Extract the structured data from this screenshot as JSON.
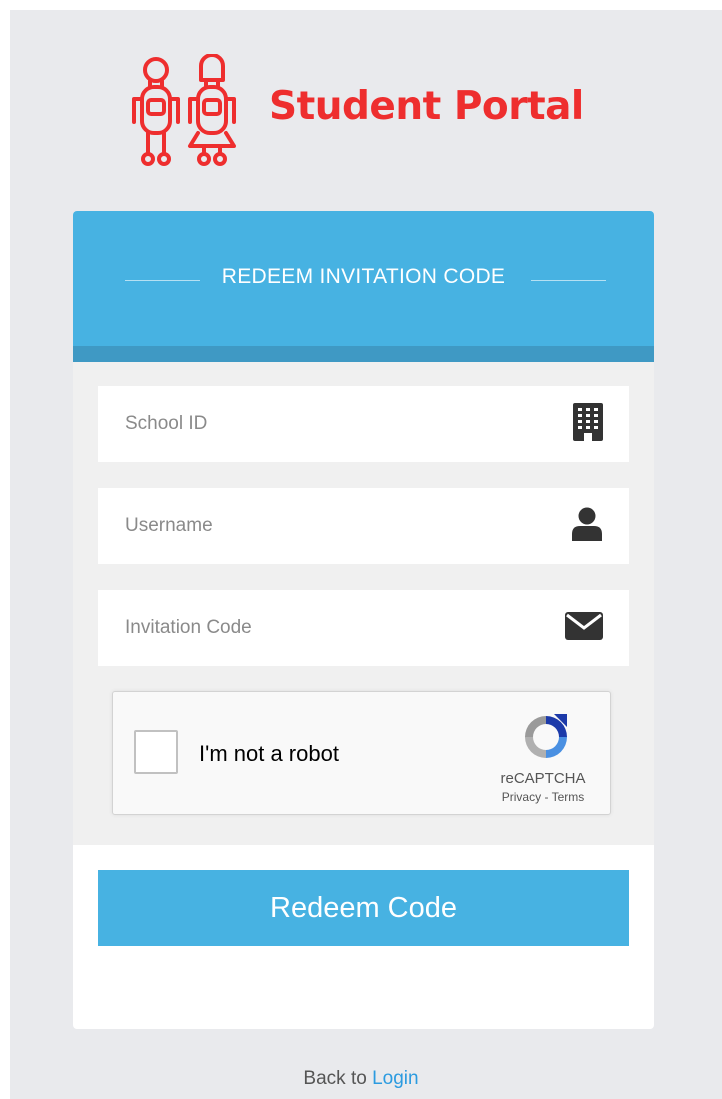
{
  "brand": {
    "title": "Student Portal",
    "logo_icon": "students-icon",
    "color": "#ee2e2e"
  },
  "card": {
    "header_title": "REDEEM INVITATION CODE",
    "header_color": "#47b2e2"
  },
  "form": {
    "school_id": {
      "placeholder": "School ID",
      "value": "",
      "icon": "building-icon"
    },
    "username": {
      "placeholder": "Username",
      "value": "",
      "icon": "user-icon"
    },
    "invitation_code": {
      "placeholder": "Invitation Code",
      "value": "",
      "icon": "envelope-icon"
    }
  },
  "recaptcha": {
    "label": "I'm not a robot",
    "brand": "reCAPTCHA",
    "privacy": "Privacy",
    "separator": " - ",
    "terms": "Terms",
    "checked": false
  },
  "submit": {
    "label": "Redeem Code"
  },
  "footer": {
    "prefix": "Back to ",
    "link_label": "Login"
  }
}
